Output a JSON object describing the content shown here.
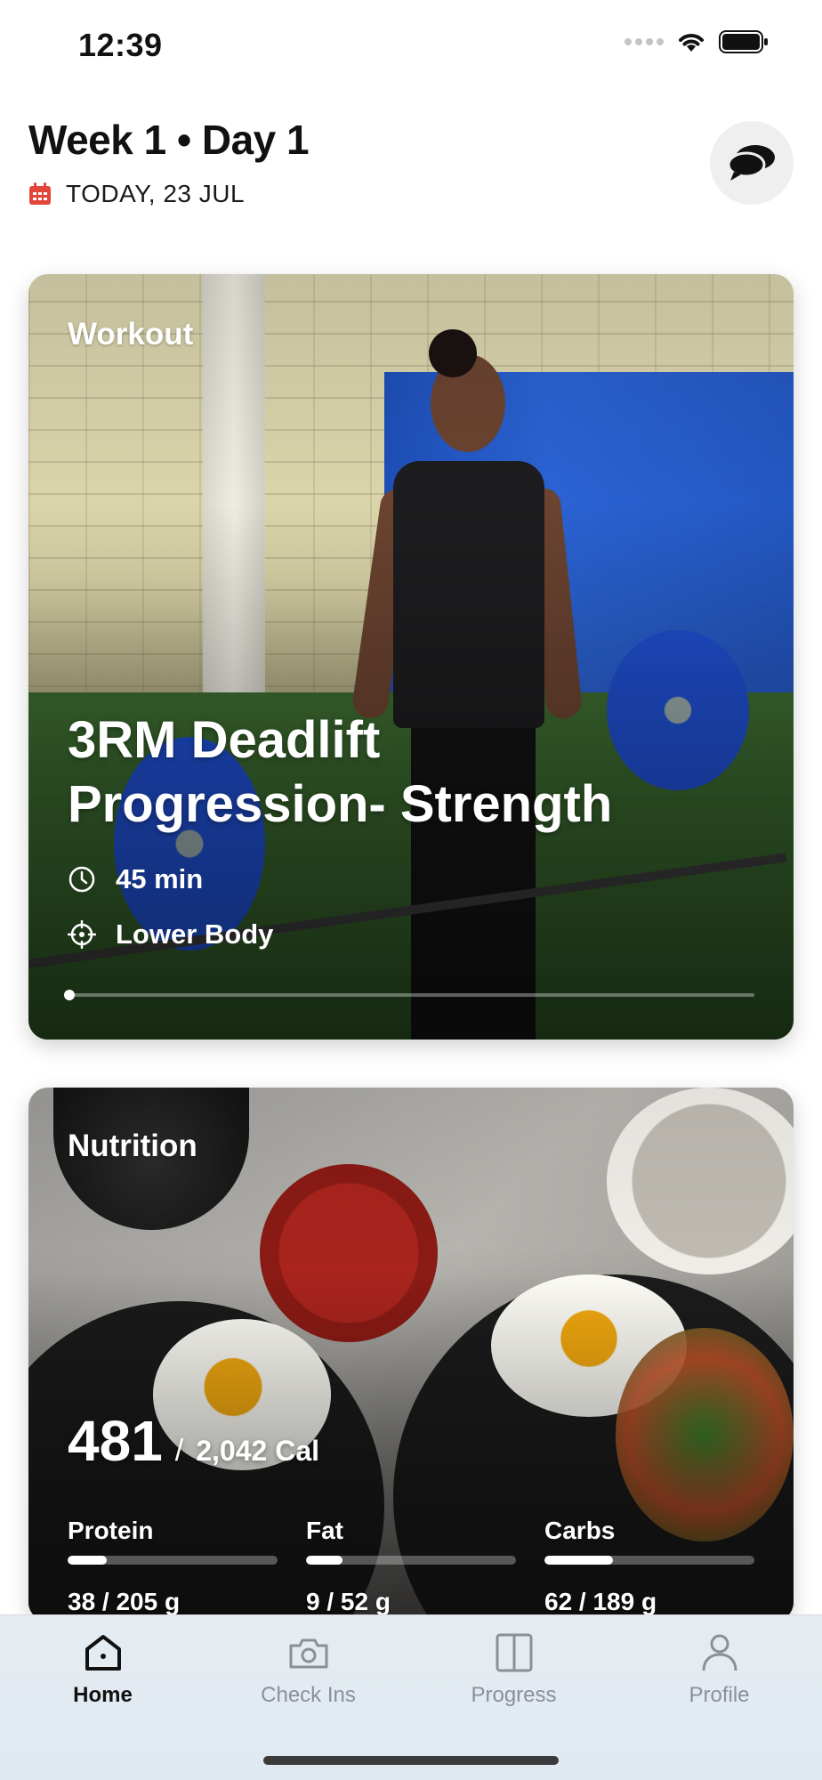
{
  "status_bar": {
    "time": "12:39",
    "icons": [
      "signal-icon",
      "wifi-icon",
      "battery-icon"
    ]
  },
  "header": {
    "title": "Week 1 • Day 1",
    "date": "TODAY, 23 JUL",
    "date_icon": "calendar-icon",
    "chat_icon": "chat-bubbles-icon"
  },
  "workout_card": {
    "label": "Workout",
    "title_line1": "3RM Deadlift",
    "title_line2": "Progression- Strength",
    "duration": "45 min",
    "duration_icon": "clock-icon",
    "area": "Lower Body",
    "area_icon": "target-icon",
    "progress_fraction": 0.0
  },
  "nutrition_card": {
    "label": "Nutrition",
    "calories_consumed": "481",
    "calories_separator": "/",
    "calories_target": "2,042 Cal",
    "macros": [
      {
        "name": "Protein",
        "value": "38 / 205 g",
        "fraction": 0.185
      },
      {
        "name": "Fat",
        "value": "9 / 52 g",
        "fraction": 0.173
      },
      {
        "name": "Carbs",
        "value": "62 / 189 g",
        "fraction": 0.328
      }
    ]
  },
  "tab_bar": {
    "tabs": [
      {
        "label": "Home",
        "icon": "home-icon",
        "active": true
      },
      {
        "label": "Check Ins",
        "icon": "camera-icon",
        "active": false
      },
      {
        "label": "Progress",
        "icon": "compare-icon",
        "active": false
      },
      {
        "label": "Profile",
        "icon": "person-icon",
        "active": false
      }
    ]
  },
  "colors": {
    "calendar_accent": "#e2463a",
    "active_tab": "#111111",
    "inactive_tab": "#8a9097",
    "tab_bar_bg": "#e4ebf1"
  }
}
